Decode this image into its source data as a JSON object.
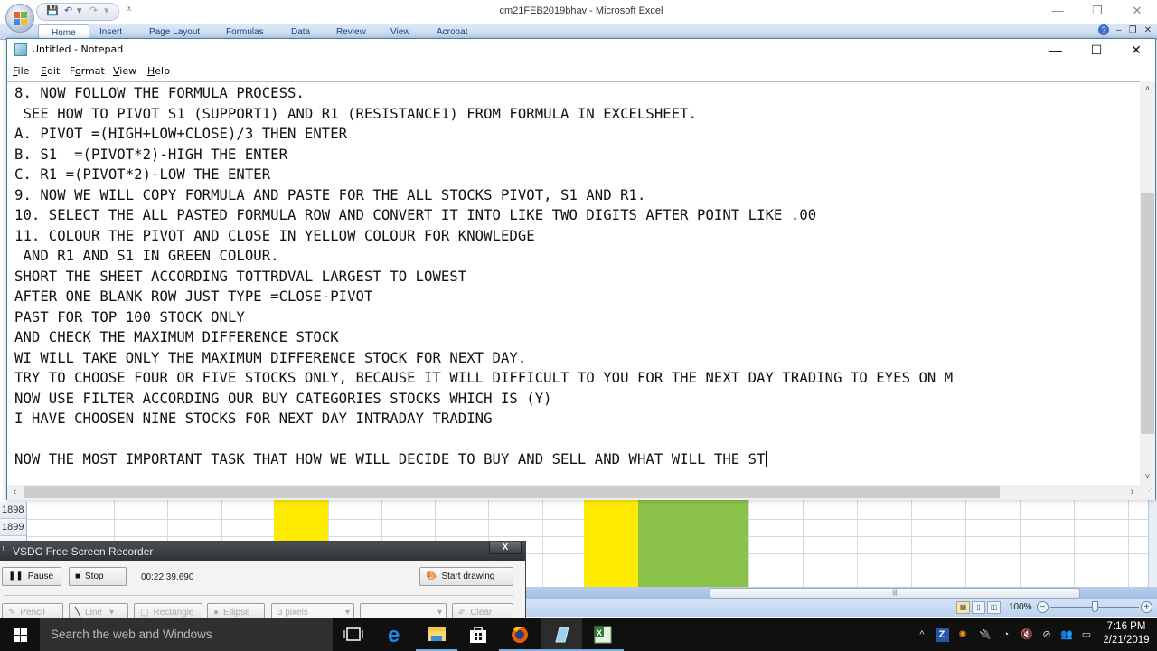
{
  "excel": {
    "title": "cm21FEB2019bhav - Microsoft Excel",
    "window_buttons": [
      "—",
      "❐",
      "✕"
    ],
    "ribbon_tabs": [
      "Home",
      "Insert",
      "Page Layout",
      "Formulas",
      "Data",
      "Review",
      "View",
      "Acrobat"
    ],
    "active_tab": "Home",
    "row_headers": [
      "1898",
      "1899"
    ],
    "colors": {
      "yellow": "#ffeb00",
      "green": "#8bc34a"
    },
    "status": {
      "zoom": "100%"
    }
  },
  "notepad": {
    "title": "Untitled - Notepad",
    "menu": [
      {
        "label": "File",
        "accel": "F"
      },
      {
        "label": "Edit",
        "accel": "E"
      },
      {
        "label": "Format",
        "accel": "o"
      },
      {
        "label": "View",
        "accel": "V"
      },
      {
        "label": "Help",
        "accel": "H"
      }
    ],
    "lines": [
      "8. NOW FOLLOW THE FORMULA PROCESS.",
      " SEE HOW TO PIVOT S1 (SUPPORT1) AND R1 (RESISTANCE1) FROM FORMULA IN EXCELSHEET.",
      "A. PIVOT =(HIGH+LOW+CLOSE)/3 THEN ENTER",
      "B. S1  =(PIVOT*2)-HIGH THE ENTER",
      "C. R1 =(PIVOT*2)-LOW THE ENTER",
      "9. NOW WE WILL COPY FORMULA AND PASTE FOR THE ALL STOCKS PIVOT, S1 AND R1.",
      "10. SELECT THE ALL PASTED FORMULA ROW AND CONVERT IT INTO LIKE TWO DIGITS AFTER POINT LIKE .00",
      "11. COLOUR THE PIVOT AND CLOSE IN YELLOW COLOUR FOR KNOWLEDGE",
      " AND R1 AND S1 IN GREEN COLOUR.",
      "SHORT THE SHEET ACCORDING TOTTRDVAL LARGEST TO LOWEST",
      "AFTER ONE BLANK ROW JUST TYPE =CLOSE-PIVOT",
      "PAST FOR TOP 100 STOCK ONLY",
      "AND CHECK THE MAXIMUM DIFFERENCE STOCK",
      "WI WILL TAKE ONLY THE MAXIMUM DIFFERENCE STOCK FOR NEXT DAY.",
      "TRY TO CHOOSE FOUR OR FIVE STOCKS ONLY, BECAUSE IT WILL DIFFICULT TO YOU FOR THE NEXT DAY TRADING TO EYES ON M",
      "NOW USE FILTER ACCORDING OUR BUY CATEGORIES STOCKS WHICH IS (Y)",
      "I HAVE CHOOSEN NINE STOCKS FOR NEXT DAY INTRADAY TRADING",
      "",
      "NOW THE MOST IMPORTANT TASK THAT HOW WE WILL DECIDE TO BUY AND SELL AND WHAT WILL THE ST"
    ]
  },
  "recorder": {
    "title": "VSDC Free Screen Recorder",
    "close": "X",
    "pause_label": "Pause",
    "stop_label": "Stop",
    "elapsed": "00:22:39.690",
    "start_drawing_label": "Start drawing",
    "tools": {
      "pencil": "Pencil",
      "line": "Line",
      "rectangle": "Rectangle",
      "ellipse": "Ellipse",
      "thickness": "3 pixels",
      "color": "",
      "clear": "Clear"
    }
  },
  "taskbar": {
    "search_placeholder": "Search the web and Windows",
    "apps": [
      "task-view",
      "edge",
      "file-explorer",
      "store",
      "firefox",
      "notepad",
      "excel"
    ],
    "tray": [
      "show-hidden-icons",
      "zotero",
      "avast",
      "power",
      "wifi",
      "volume-muted",
      "network",
      "people",
      "action-center"
    ],
    "time": "7:16 PM",
    "date": "2/21/2019"
  }
}
